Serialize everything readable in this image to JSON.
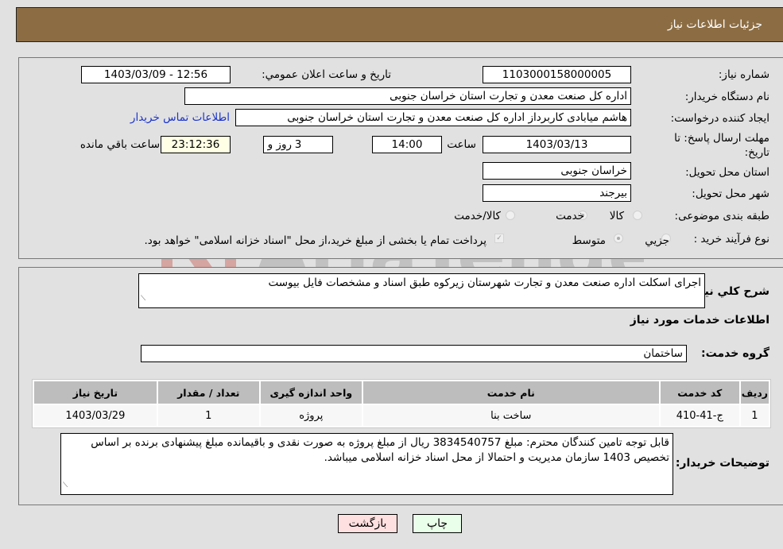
{
  "header": {
    "title": "جزئیات اطلاعات نیاز"
  },
  "form": {
    "need_number": {
      "label": "شماره نیاز:",
      "value": "1103000158000005"
    },
    "announce_datetime": {
      "label": "تاریخ و ساعت اعلان عمومي:",
      "value": "1403/03/09 - 12:56"
    },
    "buyer_org": {
      "label": "نام دستگاه خریدار:",
      "value": "اداره کل صنعت  معدن و تجارت استان خراسان جنوبی"
    },
    "requester": {
      "label": "ایجاد کننده درخواست:",
      "value": "هاشم میابادی کاربرداز اداره کل صنعت  معدن و تجارت استان خراسان جنوبی"
    },
    "buyer_contact_link": "اطلاعات تماس خریدار",
    "deadline": {
      "label": "مهلت ارسال پاسخ: تا تاریخ:",
      "date": "1403/03/13",
      "time_label": "ساعت",
      "time": "14:00",
      "days": "3",
      "days_label": "روز و",
      "remaining": "23:12:36",
      "remaining_label": "ساعت باقي مانده"
    },
    "delivery_province": {
      "label": "استان محل تحویل:",
      "value": "خراسان جنوبی"
    },
    "delivery_city": {
      "label": "شهر محل تحویل:",
      "value": "بیرجند"
    },
    "category": {
      "label": "طبقه بندی موضوعی:",
      "options": [
        "کالا",
        "خدمت",
        "کالا/خدمت"
      ],
      "selected": "خدمت"
    },
    "purchase_type": {
      "label": "نوع فرآیند خرید :",
      "options": [
        "جزيي",
        "متوسط"
      ],
      "selected": "متوسط",
      "treasury_note": "پرداخت تمام یا بخشی از مبلغ خرید،از محل \"اسناد خزانه اسلامی\" خواهد بود."
    }
  },
  "details": {
    "description_label": "شرح کلي نیاز:",
    "description": "اجرای اسکلت اداره صنعت معدن و تجارت شهرستان زیرکوه طبق اسناد و مشخصات فایل بیوست",
    "services_heading": "اطلاعات خدمات مورد نیاز",
    "service_group_label": "گروه خدمت:",
    "service_group": "ساختمان",
    "table": {
      "headers": [
        "ردیف",
        "کد خدمت",
        "نام خدمت",
        "واحد اندازه گیری",
        "تعداد / مقدار",
        "تاریخ نیاز"
      ],
      "rows": [
        [
          "1",
          "ج-41-410",
          "ساخت بنا",
          "پروژه",
          "1",
          "1403/03/29"
        ]
      ]
    },
    "buyer_notes_label": "توضیحات خریدار:",
    "buyer_notes": "قابل توجه تامین کنندگان محترم: مبلغ 3834540757 ریال از مبلغ پروژه به صورت نقدی و باقیمانده مبلغ پیشنهادی برنده بر اساس تخصیص 1403 سازمان مدیریت و احتمالا از محل اسناد خزانه اسلامی میباشد."
  },
  "buttons": {
    "print": "چاپ",
    "back": "بازگشت"
  },
  "colors": {
    "header_bg": "#8c6d43",
    "back_btn_bg": "#ffe0e0",
    "print_btn_bg": "#eaffea",
    "link": "#1a33cc"
  }
}
